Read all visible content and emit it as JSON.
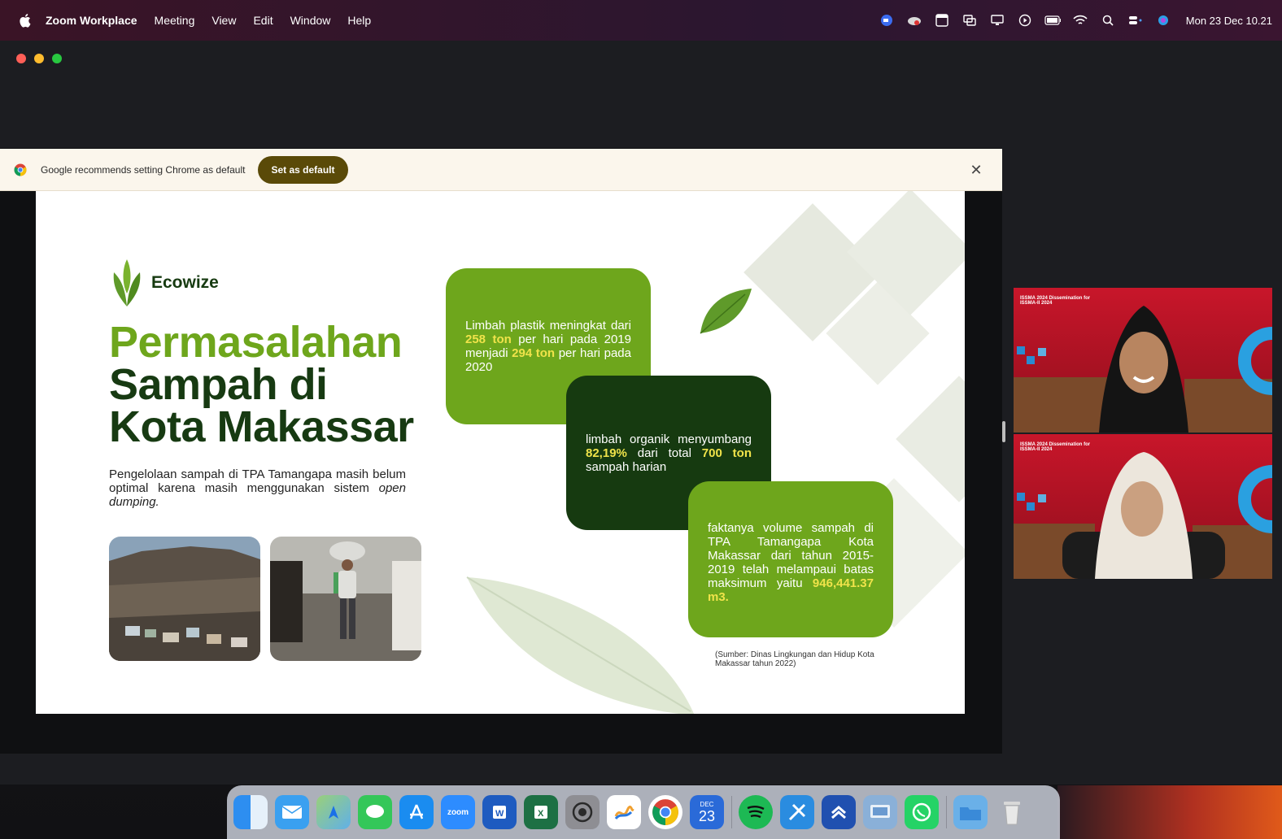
{
  "menubar": {
    "app_name": "Zoom Workplace",
    "items": [
      "Meeting",
      "View",
      "Edit",
      "Window",
      "Help"
    ],
    "clock": "Mon 23 Dec  10.21",
    "status_icons": [
      "zoom-status-icon",
      "creative-cloud-icon",
      "calendar-status-icon",
      "screen-mirror-icon",
      "display-icon",
      "play-icon",
      "battery-icon",
      "wifi-icon",
      "search-icon",
      "control-center-icon",
      "siri-icon"
    ]
  },
  "chrome_banner": {
    "message": "Google recommends setting Chrome as default",
    "button": "Set as default"
  },
  "slide": {
    "brand": "Ecowize",
    "title_line1": "Permasalahan",
    "title_line2": "Sampah di",
    "title_line3": "Kota Makassar",
    "intro_text": "Pengelolaan sampah di TPA Tamangapa masih belum optimal karena masih menggunakan sistem ",
    "intro_italic": "open dumping.",
    "box1": {
      "t1": "Limbah plastik meningkat dari ",
      "h1": "258 ton",
      "t2": " per hari pada 2019 menjadi ",
      "h2": "294 ton",
      "t3": " per hari pada 2020"
    },
    "box2": {
      "t1": "limbah organik menyumbang ",
      "h1": "82,19%",
      "t2": " dari total ",
      "h2": "700 ton",
      "t3": " sampah harian"
    },
    "box3": {
      "t1": "faktanya volume sampah di TPA Tamangapa Kota Makassar dari tahun 2015-2019 telah melampaui batas maksimum yaitu ",
      "h1": "946,441.37 m3."
    },
    "source": "(Sumber: Dinas Lingkungan dan Hidup Kota Makassar tahun 2022)"
  },
  "video": {
    "tile1_label": "ISSMA 2024 Dissemination for ISSMA-II 2024",
    "tile2_label": "ISSMA 2024 Dissemination for ISSMA-II 2024"
  },
  "dock": {
    "apps": [
      "finder-icon",
      "mail-icon",
      "maps-icon",
      "messages-icon",
      "app-store-icon",
      "zoom-icon",
      "word-icon",
      "excel-icon",
      "system-settings-icon",
      "freeform-icon",
      "chrome-icon",
      "calendar-icon",
      "spotify-icon",
      "xcode-icon",
      "another-app-icon",
      "preview-icon",
      "whatsapp-icon",
      "applications-folder-icon",
      "trash-icon"
    ],
    "calendar_month": "DEC",
    "calendar_day": "23",
    "zoom_label": "zoom"
  }
}
